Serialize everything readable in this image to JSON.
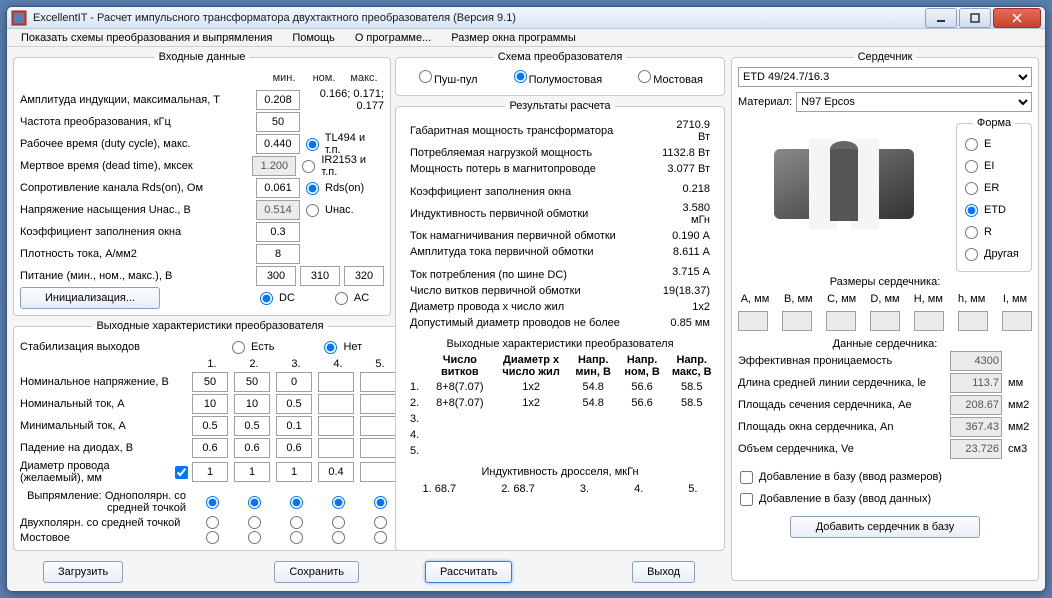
{
  "window": {
    "title": "ExcellentIT - Расчет импульсного трансформатора двухтактного преобразователя (Версия 9.1)"
  },
  "menubar": [
    "Показать схемы преобразования и выпрямления",
    "Помощь",
    "О программе...",
    "Размер окна программы"
  ],
  "input": {
    "title": "Входные данные",
    "col_heads": {
      "min": "мин.",
      "nom": "ном.",
      "max": "макс."
    },
    "ampl": {
      "label": "Амплитуда индукции, максимальная, Т",
      "val": "0.208",
      "hint": "0.166; 0.171; 0.177"
    },
    "freq": {
      "label": "Частота преобразования, кГц",
      "val": "50"
    },
    "duty": {
      "label": "Рабочее время (duty cycle), макс.",
      "val": "0.440",
      "r1": "TL494 и т.п."
    },
    "dead": {
      "label": "Мертвое время (dead time), мксек",
      "val": "1.200",
      "r2": "IR2153 и т.п."
    },
    "rds": {
      "label": "Сопротивление канала Rds(on), Ом",
      "val": "0.061",
      "r3": "Rds(on)"
    },
    "usat": {
      "label": "Напряжение насыщения Uнас., В",
      "val": "0.514",
      "r4": "Uнас."
    },
    "kfill": {
      "label": "Коэффициент заполнения окна",
      "val": "0.3"
    },
    "jdens": {
      "label": "Плотность тока, А/мм2",
      "val": "8"
    },
    "supply": {
      "label": "Питание (мин., ном., макс.), В",
      "v1": "300",
      "v2": "310",
      "v3": "320"
    },
    "init_btn": "Инициализация...",
    "dc": "DC",
    "ac": "AC"
  },
  "outchar": {
    "title": "Выходные характеристики преобразователя",
    "stab": "Стабилизация выходов",
    "yes": "Есть",
    "no": "Нет",
    "cols": [
      "1.",
      "2.",
      "3.",
      "4.",
      "5."
    ],
    "rows": {
      "vnom": {
        "label": "Номинальное напряжение, В",
        "v": [
          "50",
          "50",
          "0",
          "",
          ""
        ]
      },
      "inom": {
        "label": "Номинальный ток, А",
        "v": [
          "10",
          "10",
          "0.5",
          "",
          ""
        ]
      },
      "imin": {
        "label": "Минимальный ток, А",
        "v": [
          "0.5",
          "0.5",
          "0.1",
          "",
          ""
        ]
      },
      "vdrop": {
        "label": "Падение на диодах, В",
        "v": [
          "0.6",
          "0.6",
          "0.6",
          "",
          ""
        ]
      },
      "wire": {
        "label": "Диаметр провода (желаемый), мм",
        "chk": true,
        "v": [
          "1",
          "1",
          "1",
          "0.4",
          ""
        ]
      }
    },
    "rect_label": "Выпрямление:",
    "rects": [
      "Однополярн. со средней точкой",
      "Двухполярн. со средней точкой",
      "Мостовое"
    ]
  },
  "btns": {
    "load": "Загрузить",
    "save": "Сохранить",
    "calc": "Рассчитать",
    "exit": "Выход",
    "addcore": "Добавить сердечник в базу"
  },
  "scheme": {
    "title": "Схема преобразователя",
    "push": "Пуш-пул",
    "half": "Полумостовая",
    "full": "Мостовая"
  },
  "results": {
    "title": "Результаты расчета",
    "items": [
      {
        "l": "Габаритная мощность трансформатора",
        "v": "2710.9 Вт"
      },
      {
        "l": "Потребляемая нагрузкой мощность",
        "v": "1132.8 Вт"
      },
      {
        "l": "Мощность потерь в магнитопроводе",
        "v": "3.077 Вт"
      },
      {
        "l": "Коэффициент заполнения окна",
        "v": "0.218"
      },
      {
        "l": "Индуктивность первичной обмотки",
        "v": "3.580 мГн"
      },
      {
        "l": "Ток намагничивания первичной обмотки",
        "v": "0.190 А"
      },
      {
        "l": "Амплитуда тока первичной обмотки",
        "v": "8.611 А"
      },
      {
        "l": "Ток потребления (по шине DC)",
        "v": "3.715 А"
      },
      {
        "l": "Число витков первичной обмотки",
        "v": "19(18.37)"
      },
      {
        "l": "Диаметр провода x число жил",
        "v": "1x2"
      },
      {
        "l": "Допустимый диаметр проводов не более",
        "v": "0.85 мм"
      }
    ],
    "out_title": "Выходные характеристики преобразователя",
    "out_heads": [
      "",
      "Число витков",
      "Диаметр x число жил",
      "Напр. мин, В",
      "Напр. ном, В",
      "Напр. макс, В"
    ],
    "out_rows": [
      {
        "n": "1.",
        "turns": "8+8(7.07)",
        "dia": "1x2",
        "vmin": "54.8",
        "vnom": "56.6",
        "vmax": "58.5"
      },
      {
        "n": "2.",
        "turns": "8+8(7.07)",
        "dia": "1x2",
        "vmin": "54.8",
        "vnom": "56.6",
        "vmax": "58.5"
      },
      {
        "n": "3.",
        "turns": "",
        "dia": "",
        "vmin": "",
        "vnom": "",
        "vmax": ""
      },
      {
        "n": "4.",
        "turns": "",
        "dia": "",
        "vmin": "",
        "vnom": "",
        "vmax": ""
      },
      {
        "n": "5.",
        "turns": "",
        "dia": "",
        "vmin": "",
        "vnom": "",
        "vmax": ""
      }
    ],
    "choke_title": "Индуктивность дросселя, мкГн",
    "choke": [
      "1. 68.7",
      "2. 68.7",
      "3.",
      "4.",
      "5."
    ]
  },
  "core": {
    "title": "Сердечник",
    "type": "ETD 49/24.7/16.3",
    "mat_label": "Материал:",
    "mat": "N97 Epcos",
    "shape_title": "Форма",
    "shapes": [
      "E",
      "EI",
      "ER",
      "ETD",
      "R",
      "Другая"
    ],
    "dims_title": "Размеры сердечника:",
    "dims_heads": [
      "A, мм",
      "B, мм",
      "C, мм",
      "D, мм",
      "H, мм",
      "h, мм",
      "I, мм"
    ],
    "data_title": "Данные сердечника:",
    "data": [
      {
        "l": "Эффективная проницаемость",
        "v": "4300",
        "u": ""
      },
      {
        "l": "Длина средней линии сердечника, le",
        "v": "113.7",
        "u": "мм"
      },
      {
        "l": "Площадь сечения сердечника, Ae",
        "v": "208.67",
        "u": "мм2"
      },
      {
        "l": "Площадь окна сердечника, An",
        "v": "367.43",
        "u": "мм2"
      },
      {
        "l": "Объем сердечника, Ve",
        "v": "23.726",
        "u": "см3"
      }
    ],
    "chk1": "Добавление в базу (ввод размеров)",
    "chk2": "Добавление в базу (ввод данных)"
  }
}
